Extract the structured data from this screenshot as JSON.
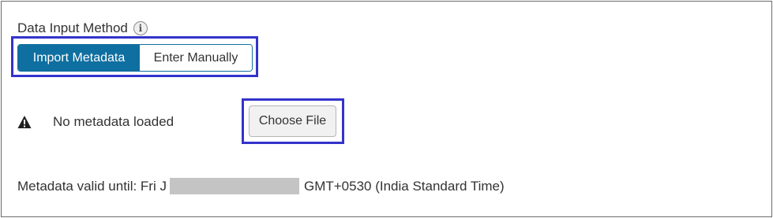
{
  "data_input": {
    "label": "Data Input Method",
    "info_icon_glyph": "i",
    "options": [
      {
        "label": "Import Metadata",
        "selected": true
      },
      {
        "label": "Enter Manually",
        "selected": false
      }
    ]
  },
  "status": {
    "icon": "warning-icon",
    "text": "No metadata loaded"
  },
  "file_picker": {
    "button_label": "Choose File"
  },
  "validity": {
    "prefix": "Metadata valid until: Fri J",
    "suffix": "GMT+0530 (India Standard Time)"
  },
  "colors": {
    "accent": "#0f6fa0",
    "highlight": "#3333cc",
    "redaction": "#c4c4c4"
  }
}
